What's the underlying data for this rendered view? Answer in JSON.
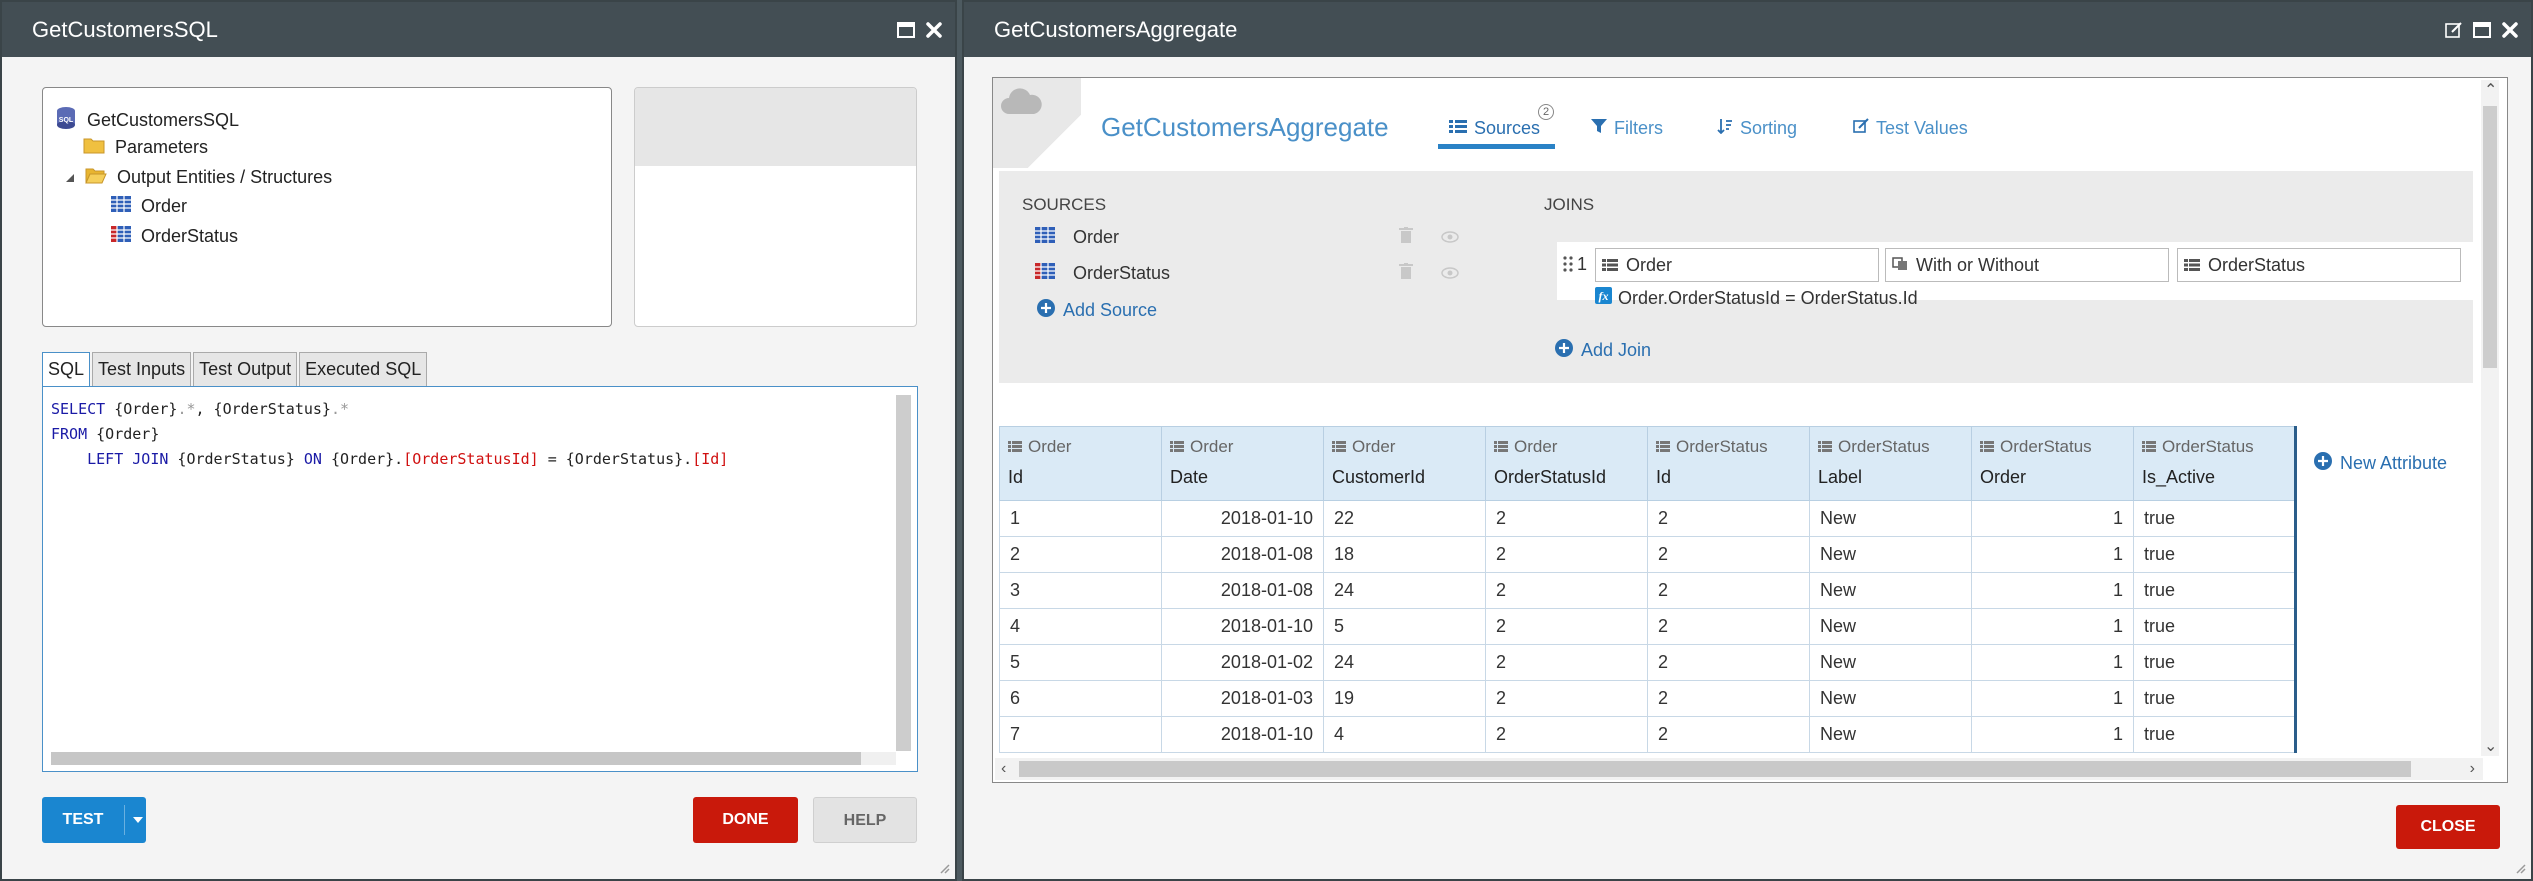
{
  "sql_window": {
    "title": "GetCustomersSQL",
    "tree": {
      "root": "GetCustomersSQL",
      "parameters": "Parameters",
      "outputs": "Output Entities / Structures",
      "entity1": "Order",
      "entity2": "OrderStatus"
    },
    "tabs": [
      "SQL",
      "Test Inputs",
      "Test Output",
      "Executed SQL"
    ],
    "code": {
      "l1_kw": "SELECT",
      "l1_a": " {Order}",
      "l1_b": ".*",
      "l1_c": ", {OrderStatus}",
      "l1_d": ".*",
      "l2_kw": "FROM",
      "l2_a": " {Order}",
      "l3_kw1": "LEFT JOIN",
      "l3_a": " {OrderStatus} ",
      "l3_kw2": "ON",
      "l3_b": " {Order}.",
      "l3_c": "[OrderStatusId]",
      "l3_d": " = {OrderStatus}.",
      "l3_e": "[Id]"
    },
    "buttons": {
      "test": "TEST",
      "done": "DONE",
      "help": "HELP"
    }
  },
  "agg_window": {
    "title": "GetCustomersAggregate",
    "aggregate_name": "GetCustomersAggregate",
    "nav": {
      "sources": "Sources",
      "sources_badge": "2",
      "filters": "Filters",
      "sorting": "Sorting",
      "test_values": "Test Values"
    },
    "sources": {
      "heading": "SOURCES",
      "items": [
        "Order",
        "OrderStatus"
      ],
      "add": "Add Source"
    },
    "joins": {
      "heading": "JOINS",
      "index": "1",
      "left": "Order",
      "type": "With or Without",
      "right": "OrderStatus",
      "condition": "Order.OrderStatusId = OrderStatus.Id",
      "add": "Add Join"
    },
    "columns": [
      {
        "entity": "Order",
        "attr": "Id"
      },
      {
        "entity": "Order",
        "attr": "Date"
      },
      {
        "entity": "Order",
        "attr": "CustomerId"
      },
      {
        "entity": "Order",
        "attr": "OrderStatusId"
      },
      {
        "entity": "OrderStatus",
        "attr": "Id"
      },
      {
        "entity": "OrderStatus",
        "attr": "Label"
      },
      {
        "entity": "OrderStatus",
        "attr": "Order"
      },
      {
        "entity": "OrderStatus",
        "attr": "Is_Active"
      }
    ],
    "rows": [
      [
        "1",
        "2018-01-10",
        "22",
        "2",
        "2",
        "New",
        "1",
        "true"
      ],
      [
        "2",
        "2018-01-08",
        "18",
        "2",
        "2",
        "New",
        "1",
        "true"
      ],
      [
        "3",
        "2018-01-08",
        "24",
        "2",
        "2",
        "New",
        "1",
        "true"
      ],
      [
        "4",
        "2018-01-10",
        "5",
        "2",
        "2",
        "New",
        "1",
        "true"
      ],
      [
        "5",
        "2018-01-02",
        "24",
        "2",
        "2",
        "New",
        "1",
        "true"
      ],
      [
        "6",
        "2018-01-03",
        "19",
        "2",
        "2",
        "New",
        "1",
        "true"
      ],
      [
        "7",
        "2018-01-10",
        "4",
        "2",
        "2",
        "New",
        "1",
        "true"
      ]
    ],
    "new_attribute": "New Attribute",
    "close": "CLOSE"
  },
  "colors": {
    "titlebar": "#434e54",
    "primary_blue": "#1a86d0",
    "link_blue": "#2a6fb0",
    "danger_red": "#c9190b",
    "header_blue": "#daeaf6"
  }
}
